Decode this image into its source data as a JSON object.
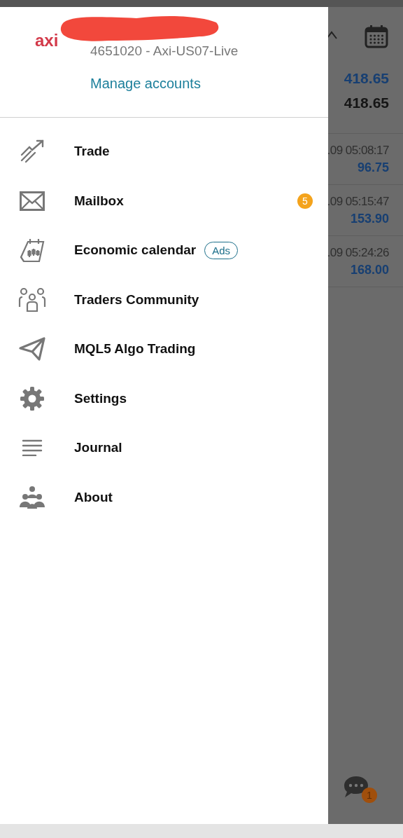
{
  "background": {
    "balances": [
      {
        "value": "418.65",
        "highlighted": true
      },
      {
        "value": "418.65",
        "highlighted": false
      }
    ],
    "deals": [
      {
        "time": ".09 05:08:17",
        "profit": "96.75"
      },
      {
        "time": ".09 05:15:47",
        "profit": "153.90"
      },
      {
        "time": ".09 05:24:26",
        "profit": "168.00"
      }
    ],
    "chat_badge": "1"
  },
  "drawer": {
    "logo": "axi",
    "account": "4651020 - Axi-US07-Live",
    "manage_link": "Manage accounts",
    "menu": [
      {
        "label": "Trade"
      },
      {
        "label": "Mailbox",
        "badge": "5"
      },
      {
        "label": "Economic calendar",
        "tag": "Ads"
      },
      {
        "label": "Traders Community"
      },
      {
        "label": "MQL5 Algo Trading"
      },
      {
        "label": "Settings"
      },
      {
        "label": "Journal"
      },
      {
        "label": "About"
      }
    ]
  }
}
